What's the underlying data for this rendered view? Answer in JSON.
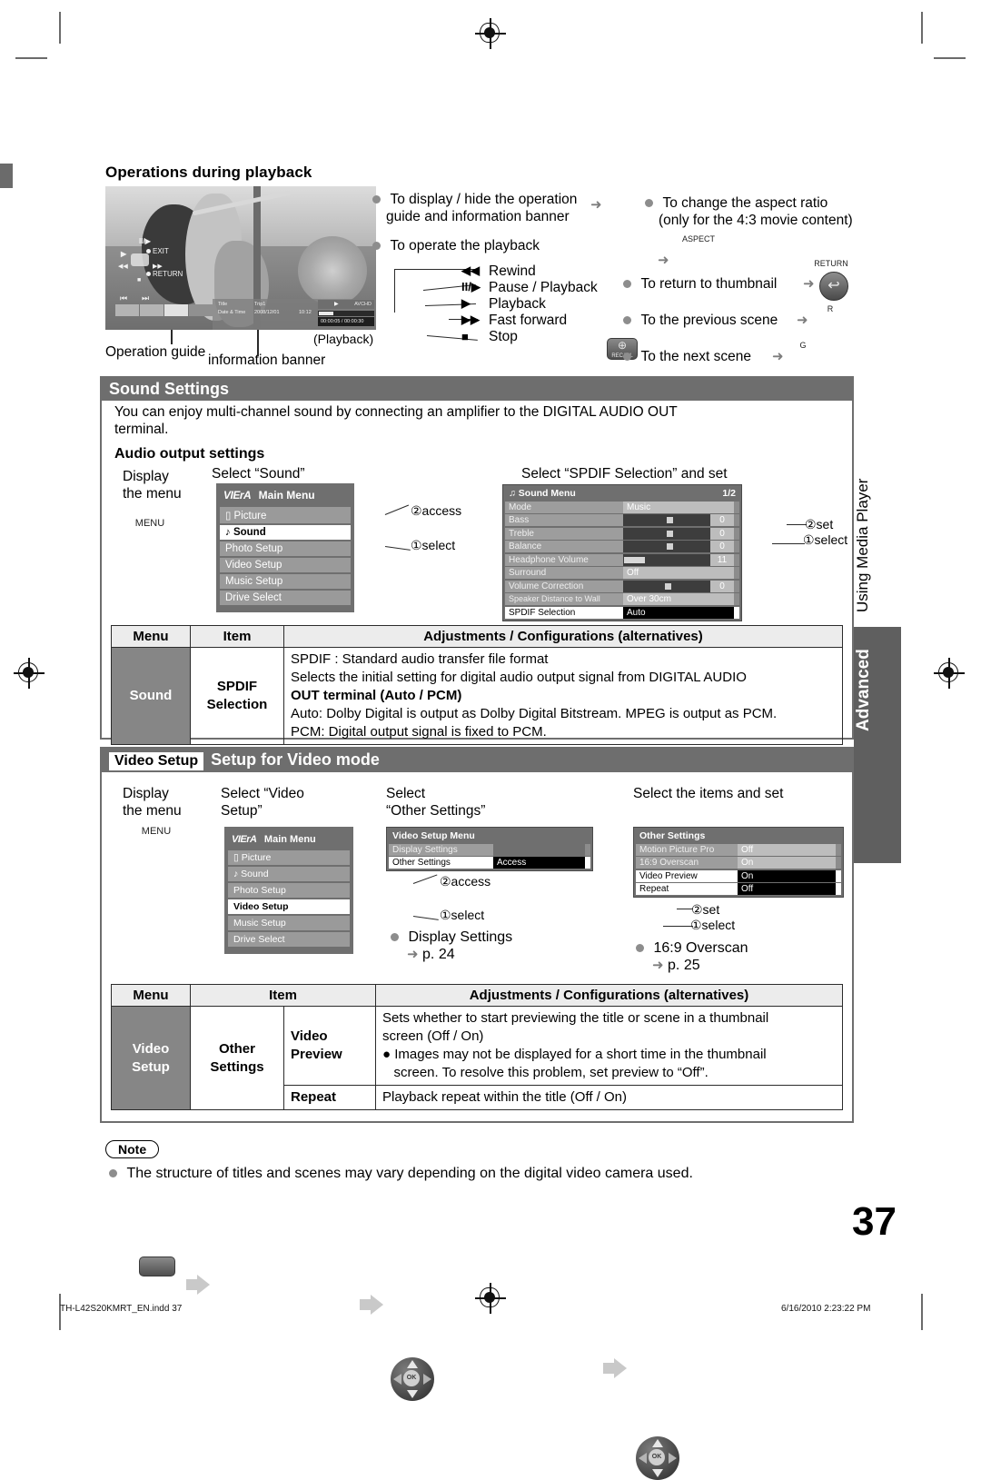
{
  "page": {
    "number": "37",
    "footer_left": "TH-L42S20KMRT_EN.indd   37",
    "footer_right": "6/16/2010   2:23:22 PM",
    "side_tab_top": "Using Media Player",
    "side_tab_bottom": "Advanced"
  },
  "playback": {
    "heading": "Operations during playback",
    "caption_operation_guide": "Operation guide",
    "caption_info_banner": "information banner",
    "caption_playback": "(Playback)",
    "still": {
      "osd_pause": "II/▶",
      "osd_play": "▶",
      "osd_rew": "◀◀",
      "osd_ff": "▶▶",
      "osd_stop": "■",
      "osd_exit": "EXIT",
      "osd_return": "RETURN",
      "osd_prev": "⏮",
      "osd_next": "⏭",
      "banner_title_label": "Title",
      "banner_title_value": "Trip1",
      "banner_date_label": "Date & Time",
      "banner_date_value": "2008/12/01",
      "banner_time_value": "10:12",
      "banner_format": "AVCHD",
      "banner_elapsed": "00:00:05 / 00:00:30"
    },
    "bullets": [
      {
        "text_line1": "To display / hide the operation",
        "text_line2": "guide and information banner"
      },
      {
        "text_line1": "To operate the playback",
        "text_line2": ""
      }
    ],
    "recall_button_label": "RECALL",
    "recall_button_glyph": "⊕",
    "dpad_functions": [
      {
        "glyph": "◀◀",
        "label": "Rewind"
      },
      {
        "glyph": "II/▶",
        "label": "Pause / Playback"
      },
      {
        "glyph": "▶",
        "label": "Playback"
      },
      {
        "glyph": "▶▶",
        "label": "Fast forward"
      },
      {
        "glyph": "■",
        "label": "Stop"
      }
    ],
    "right_bullets": {
      "aspect_line1": "To change the aspect ratio",
      "aspect_line2": "(only for the 4:3 movie content)",
      "aspect_button_label": "ASPECT",
      "aspect_button_glyph": "⊕",
      "thumbnail": "To return to thumbnail",
      "thumbnail_button_label": "RETURN",
      "thumbnail_button_glyph": "↩",
      "prev_scene": "To the previous scene",
      "prev_scene_button_label": "R",
      "next_scene": "To the next scene",
      "next_scene_button_label": "G"
    }
  },
  "sound_settings": {
    "band_title": "Sound Settings",
    "intro_line1": "You can enjoy multi-channel sound by connecting an amplifier to the DIGITAL AUDIO OUT",
    "intro_line2": "terminal.",
    "sub_heading": "Audio output settings",
    "steps": {
      "display_line1": "Display",
      "display_line2": "the menu",
      "menu_button": "MENU",
      "select_sound": "Select “Sound”",
      "select_spdif": "Select “SPDIF Selection” and set",
      "access_label": "②access",
      "select_label": "①select",
      "set_label": "②set",
      "select_label2": "①select"
    },
    "main_menu": {
      "brand": "VIErA",
      "title": "Main Menu",
      "items": [
        {
          "label": "Picture",
          "icon": "picture-icon",
          "selected": false
        },
        {
          "label": "Sound",
          "icon": "note-icon",
          "selected": true
        },
        {
          "label": "Photo Setup",
          "icon": "",
          "selected": false
        },
        {
          "label": "Video Setup",
          "icon": "",
          "selected": false
        },
        {
          "label": "Music Setup",
          "icon": "",
          "selected": false
        },
        {
          "label": "Drive Select",
          "icon": "",
          "selected": false
        }
      ]
    },
    "sound_menu": {
      "title": "Sound Menu",
      "page": "1/2",
      "rows": [
        {
          "label": "Mode",
          "value": "Music",
          "type": "text",
          "highlight": false
        },
        {
          "label": "Bass",
          "value": "0",
          "type": "slider",
          "pos": 50,
          "highlight": false
        },
        {
          "label": "Treble",
          "value": "0",
          "type": "slider",
          "pos": 50,
          "highlight": false
        },
        {
          "label": "Balance",
          "value": "0",
          "type": "slider",
          "pos": 50,
          "highlight": false
        },
        {
          "label": "Headphone Volume",
          "value": "11",
          "type": "bar",
          "pos": 22,
          "highlight": false
        },
        {
          "label": "Surround",
          "value": "Off",
          "type": "text",
          "highlight": false
        },
        {
          "label": "Volume Correction",
          "value": "0",
          "type": "slider",
          "pos": 48,
          "highlight": false
        },
        {
          "label": "Speaker Distance to Wall",
          "value": "Over 30cm",
          "type": "text",
          "highlight": false
        },
        {
          "label": "SPDIF Selection",
          "value": "Auto",
          "type": "text",
          "highlight": true
        }
      ]
    },
    "table": {
      "headers": [
        "Menu",
        "Item",
        "Adjustments / Configurations (alternatives)"
      ],
      "row": {
        "menu": "Sound",
        "item": "SPDIF Selection",
        "lines": [
          "SPDIF : Standard audio transfer file format",
          "Selects the initial setting for digital audio output signal from DIGITAL AUDIO",
          "OUT terminal (Auto / PCM)",
          "Auto: Dolby Digital is output as Dolby Digital Bitstream. MPEG is output as PCM.",
          "PCM: Digital output signal is fixed to PCM."
        ]
      }
    }
  },
  "video_setup": {
    "band_tag": "Video Setup",
    "band_title": "Setup for Video mode",
    "steps": {
      "display_line1": "Display",
      "display_line2": "the menu",
      "menu_button": "MENU",
      "select_video_line1": "Select “Video",
      "select_video_line2": "Setup”",
      "select_other_line1": "Select",
      "select_other_line2": "“Other Settings”",
      "select_items": "Select the items and set",
      "access_label": "②access",
      "select_label": "①select",
      "set_label": "②set",
      "select_label2": "①select",
      "ref_display_settings": "Display Settings",
      "ref_display_page": "p. 24",
      "ref_overscan": "16:9 Overscan",
      "ref_overscan_page": "p. 25"
    },
    "main_menu": {
      "brand": "VIErA",
      "title": "Main Menu",
      "items": [
        {
          "label": "Picture",
          "icon": "picture-icon",
          "selected": false
        },
        {
          "label": "Sound",
          "icon": "note-icon",
          "selected": false
        },
        {
          "label": "Photo Setup",
          "icon": "",
          "selected": false
        },
        {
          "label": "Video Setup",
          "icon": "",
          "selected": true
        },
        {
          "label": "Music Setup",
          "icon": "",
          "selected": false
        },
        {
          "label": "Drive Select",
          "icon": "",
          "selected": false
        }
      ]
    },
    "video_setup_menu": {
      "title": "Video Setup Menu",
      "rows": [
        {
          "label": "Display Settings",
          "value": "",
          "highlight": false
        },
        {
          "label": "Other Settings",
          "value": "Access",
          "highlight": true
        }
      ]
    },
    "other_settings_menu": {
      "title": "Other Settings",
      "rows": [
        {
          "label": "Motion Picture Pro",
          "value": "Off",
          "highlight": false
        },
        {
          "label": "16:9 Overscan",
          "value": "On",
          "highlight": false
        },
        {
          "label": "Video Preview",
          "value": "On",
          "highlight": true
        },
        {
          "label": "Repeat",
          "value": "Off",
          "highlight": true
        }
      ]
    },
    "table": {
      "headers": [
        "Menu",
        "Item",
        "Adjustments / Configurations (alternatives)"
      ],
      "menu": "Video Setup",
      "item_group": "Other Settings",
      "rows": [
        {
          "item": "Video Preview",
          "lines": [
            "Sets whether to start previewing the title or scene in a thumbnail",
            "screen (Off / On)",
            "● Images may not be displayed for a short time in the thumbnail",
            "   screen. To resolve this problem, set preview to “Off”."
          ]
        },
        {
          "item": "Repeat",
          "lines": [
            "Playback repeat within the title (Off / On)"
          ]
        }
      ]
    }
  },
  "note": {
    "tag": "Note",
    "text": "The structure of titles and scenes may vary depending on the digital video camera used."
  }
}
